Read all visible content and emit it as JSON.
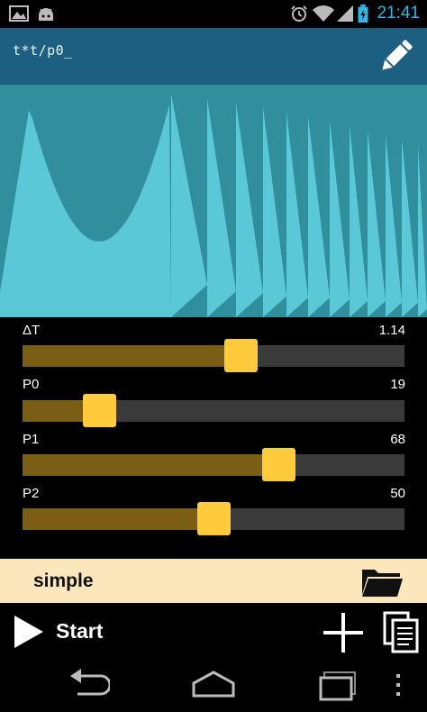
{
  "status_bar": {
    "time": "21:41",
    "left_icons": [
      "image-icon",
      "android-icon"
    ],
    "right_icons": [
      "alarm-icon",
      "wifi-icon",
      "signal-icon",
      "battery-icon"
    ]
  },
  "header": {
    "formula": "t*t/p0_",
    "edit_icon": "pencil-icon"
  },
  "sliders": [
    {
      "label": "ΔT",
      "value": "1.14",
      "level": 0.57
    },
    {
      "label": "P0",
      "value": "19",
      "level": 0.2
    },
    {
      "label": "P1",
      "value": "68",
      "level": 0.67
    },
    {
      "label": "P2",
      "value": "50",
      "level": 0.5
    }
  ],
  "preset": {
    "name": "simple",
    "open_icon": "folder-icon"
  },
  "action_bar": {
    "start_label": "Start",
    "play_icon": "play-icon",
    "add_icon": "plus-icon",
    "copy_icon": "copy-icon"
  },
  "nav": {
    "icons": [
      "back-icon",
      "home-icon",
      "recents-icon",
      "overflow-menu-icon"
    ]
  },
  "colors": {
    "header_bg": "#1d5f80",
    "viz_dark": "#318e9c",
    "viz_light": "#5bc8d8",
    "slider_fill": "#7b5e16",
    "slider_thumb": "#ffcb3c",
    "slider_track": "#3a3a3a",
    "preset_bg": "#fbe7bb",
    "accent_clock": "#33b5e5"
  }
}
